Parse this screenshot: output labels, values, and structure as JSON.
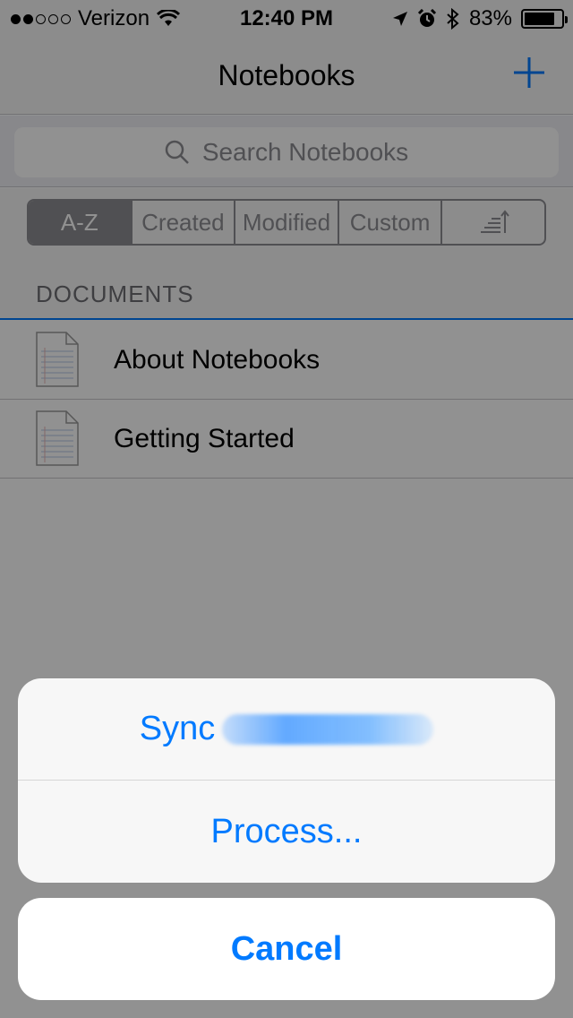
{
  "status_bar": {
    "carrier": "Verizon",
    "signal_bars_filled": 2,
    "signal_bars_total": 5,
    "time": "12:40 PM",
    "battery_percent": "83%",
    "battery_level": 0.83
  },
  "nav": {
    "title": "Notebooks",
    "add_icon": "plus-icon"
  },
  "search": {
    "placeholder": "Search Notebooks"
  },
  "sort_tabs": [
    {
      "label": "A-Z",
      "selected": true
    },
    {
      "label": "Created",
      "selected": false
    },
    {
      "label": "Modified",
      "selected": false
    },
    {
      "label": "Custom",
      "selected": false
    },
    {
      "label": "",
      "icon": "sort-order-icon",
      "selected": false
    }
  ],
  "section": {
    "title": "DOCUMENTS"
  },
  "documents": [
    {
      "name": "About Notebooks",
      "icon": "document-icon"
    },
    {
      "name": "Getting Started",
      "icon": "document-icon"
    }
  ],
  "action_sheet": {
    "actions": [
      {
        "label": "Sync",
        "redacted_suffix": true
      },
      {
        "label": "Process..."
      }
    ],
    "cancel_label": "Cancel"
  },
  "colors": {
    "accent": "#007aff",
    "overlay": "rgba(0,0,0,0.43)",
    "segment_selected": "#8e8e93"
  }
}
